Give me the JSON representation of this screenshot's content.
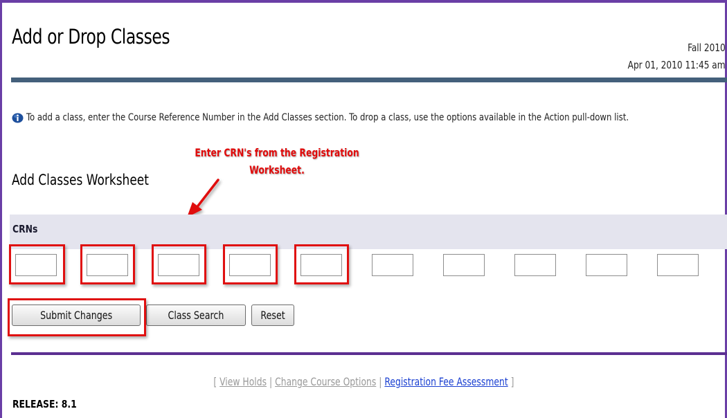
{
  "page": {
    "title": "Add or Drop Classes",
    "term": "Fall 2010",
    "datetime": "Apr 01, 2010 11:45 am"
  },
  "info": {
    "icon": "info-icon",
    "text": "To add a class, enter the Course Reference Number in the Add Classes section. To drop a class, use the options available in the Action pull-down list."
  },
  "annotation": {
    "line1": "Enter CRN's from the Registration",
    "line2": "Worksheet.",
    "color": "#e10b0b"
  },
  "worksheet": {
    "title": "Add Classes Worksheet",
    "crn_label": "CRNs",
    "crn_values": [
      "",
      "",
      "",
      "",
      "",
      "",
      "",
      "",
      "",
      ""
    ],
    "highlighted_count": 5
  },
  "buttons": {
    "submit": "Submit Changes",
    "class_search": "Class Search",
    "reset": "Reset"
  },
  "footer": {
    "bracket_open": "[",
    "bracket_close": "]",
    "separator": "|",
    "links": [
      "View Holds",
      "Change Course Options",
      "Registration Fee Assessment"
    ],
    "release": "RELEASE: 8.1"
  },
  "colors": {
    "frame": "#6a3ea6",
    "header_bar": "#44607b",
    "divider": "#5b2f91",
    "highlight": "#e01010",
    "link_active": "#1a3fd1"
  }
}
